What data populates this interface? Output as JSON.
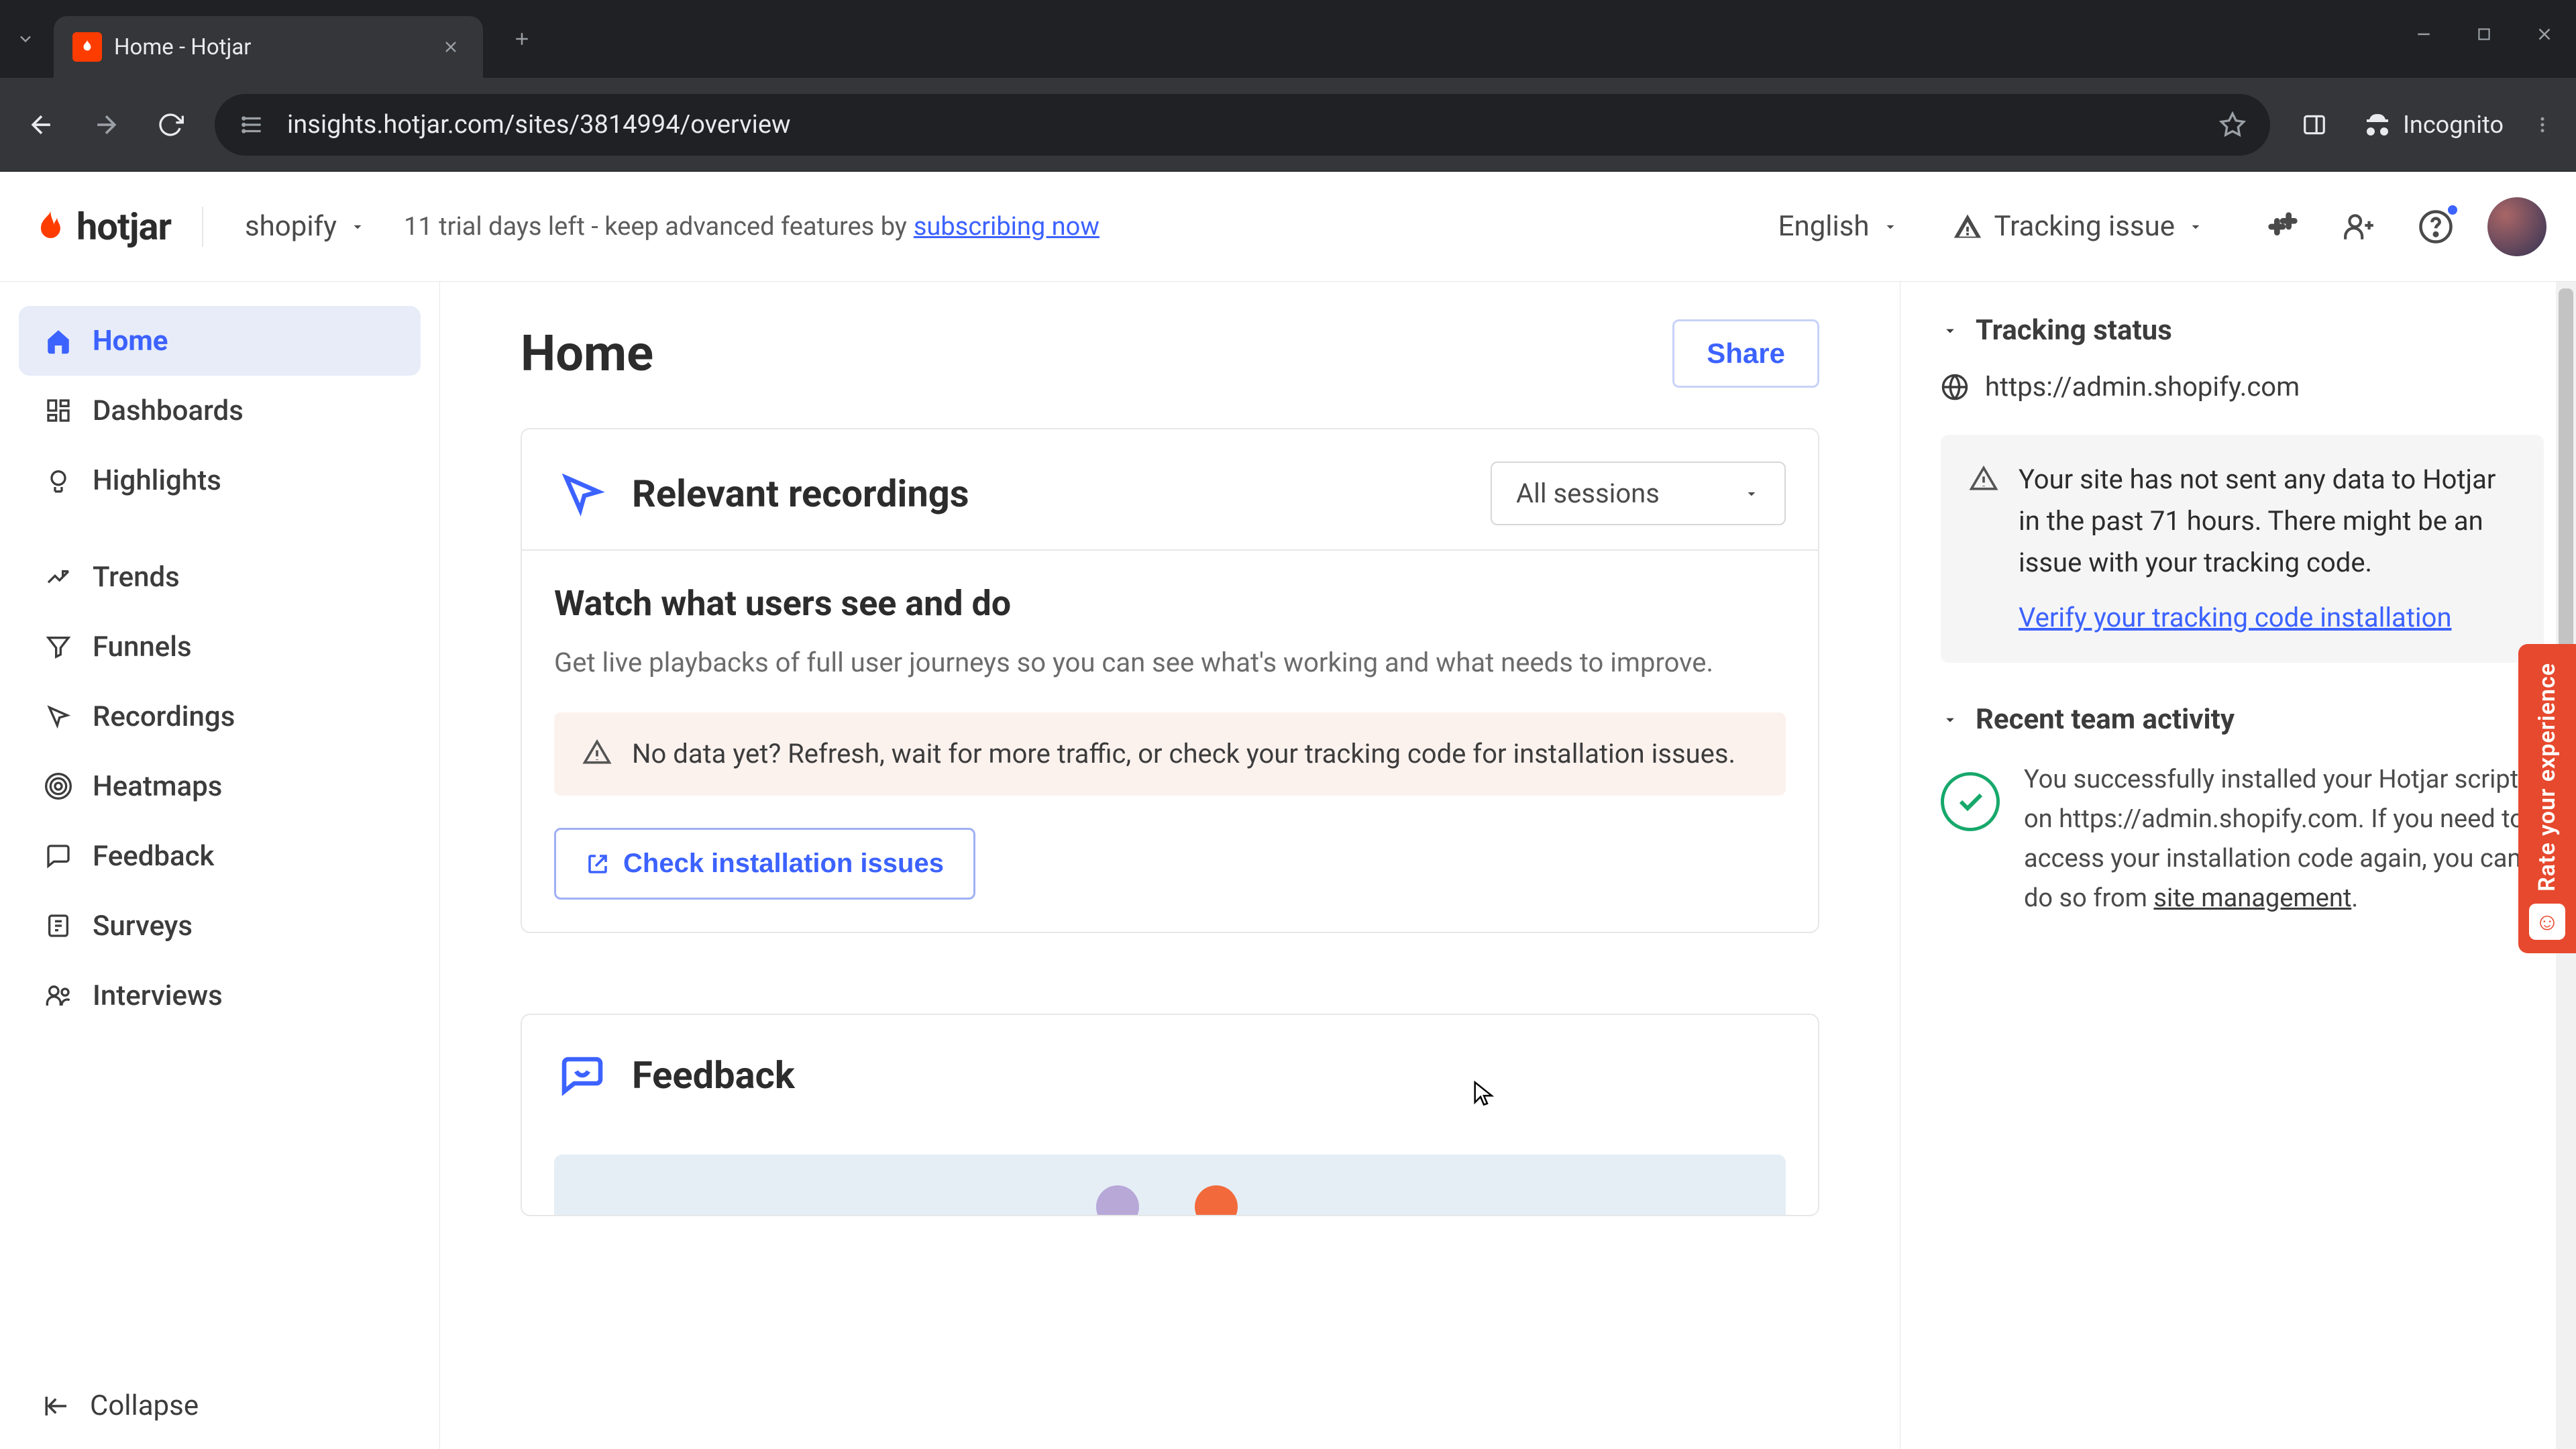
{
  "browser": {
    "tab_title": "Home - Hotjar",
    "url": "insights.hotjar.com/sites/3814994/overview",
    "incognito_label": "Incognito"
  },
  "header": {
    "brand": "hotjar",
    "site_switcher": "shopify",
    "trial_prefix": "11 trial days left - keep advanced features by ",
    "trial_link": "subscribing now",
    "language": "English",
    "tracking_label": "Tracking issue"
  },
  "sidebar": {
    "items": [
      {
        "label": "Home",
        "icon": "home-icon",
        "active": true
      },
      {
        "label": "Dashboards",
        "icon": "dashboards-icon"
      },
      {
        "label": "Highlights",
        "icon": "highlights-icon"
      },
      {
        "label": "Trends",
        "icon": "trends-icon"
      },
      {
        "label": "Funnels",
        "icon": "funnels-icon"
      },
      {
        "label": "Recordings",
        "icon": "recordings-icon"
      },
      {
        "label": "Heatmaps",
        "icon": "heatmaps-icon"
      },
      {
        "label": "Feedback",
        "icon": "feedback-icon"
      },
      {
        "label": "Surveys",
        "icon": "surveys-icon"
      },
      {
        "label": "Interviews",
        "icon": "interviews-icon"
      }
    ],
    "collapse": "Collapse"
  },
  "page": {
    "title": "Home",
    "share": "Share"
  },
  "recordings_card": {
    "title": "Relevant recordings",
    "filter": "All sessions",
    "lead": "Watch what users see and do",
    "sub": "Get live playbacks of full user journeys so you can see what's working and what needs to improve.",
    "warning": "No data yet? Refresh, wait for more traffic, or check your tracking code for installation issues.",
    "cta": "Check installation issues"
  },
  "feedback_card": {
    "title": "Feedback"
  },
  "tracking_panel": {
    "title": "Tracking status",
    "site_url": "https://admin.shopify.com",
    "warn_text": "Your site has not sent any data to Hotjar in the past 71 hours. There might be an issue with your tracking code.",
    "verify_link": "Verify your tracking code installation"
  },
  "activity_panel": {
    "title": "Recent team activity",
    "item_text_pre": "You successfully installed your Hotjar script on https://admin.shopify.com. If you need to access your installation code again, you can do so from ",
    "item_link": "site management",
    "item_text_post": "."
  },
  "feedback_tab": "Rate your experience"
}
